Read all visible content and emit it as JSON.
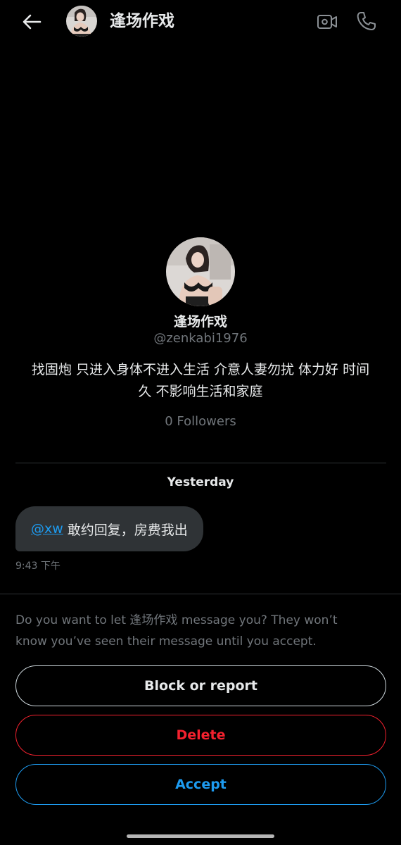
{
  "header": {
    "title": "逢场作戏",
    "back_icon": "arrow-left-icon",
    "video_icon": "video-camera-icon",
    "call_icon": "phone-icon"
  },
  "profile": {
    "name": "逢场作戏",
    "handle": "@zenkabi1976",
    "bio": "找固炮 只进入身体不进入生活 介意人妻勿扰 体力好 时间久 不影响生活和家庭",
    "followers_count": "0",
    "followers_label": "Followers"
  },
  "conversation": {
    "date_label": "Yesterday",
    "messages": [
      {
        "mention": "@xw",
        "text": "敢约回复，房费我出",
        "time": "9:43 下午"
      }
    ]
  },
  "request": {
    "prompt": "Do you want to let 逢场作戏 message you? They won’t know you’ve seen their message until you accept.",
    "block_label": "Block or report",
    "delete_label": "Delete",
    "accept_label": "Accept"
  },
  "colors": {
    "background": "#000000",
    "text_primary": "#e7e9ea",
    "text_secondary": "#71767b",
    "bubble": "#2f3336",
    "accent_blue": "#1d9bf0",
    "danger_red": "#f4212e"
  }
}
